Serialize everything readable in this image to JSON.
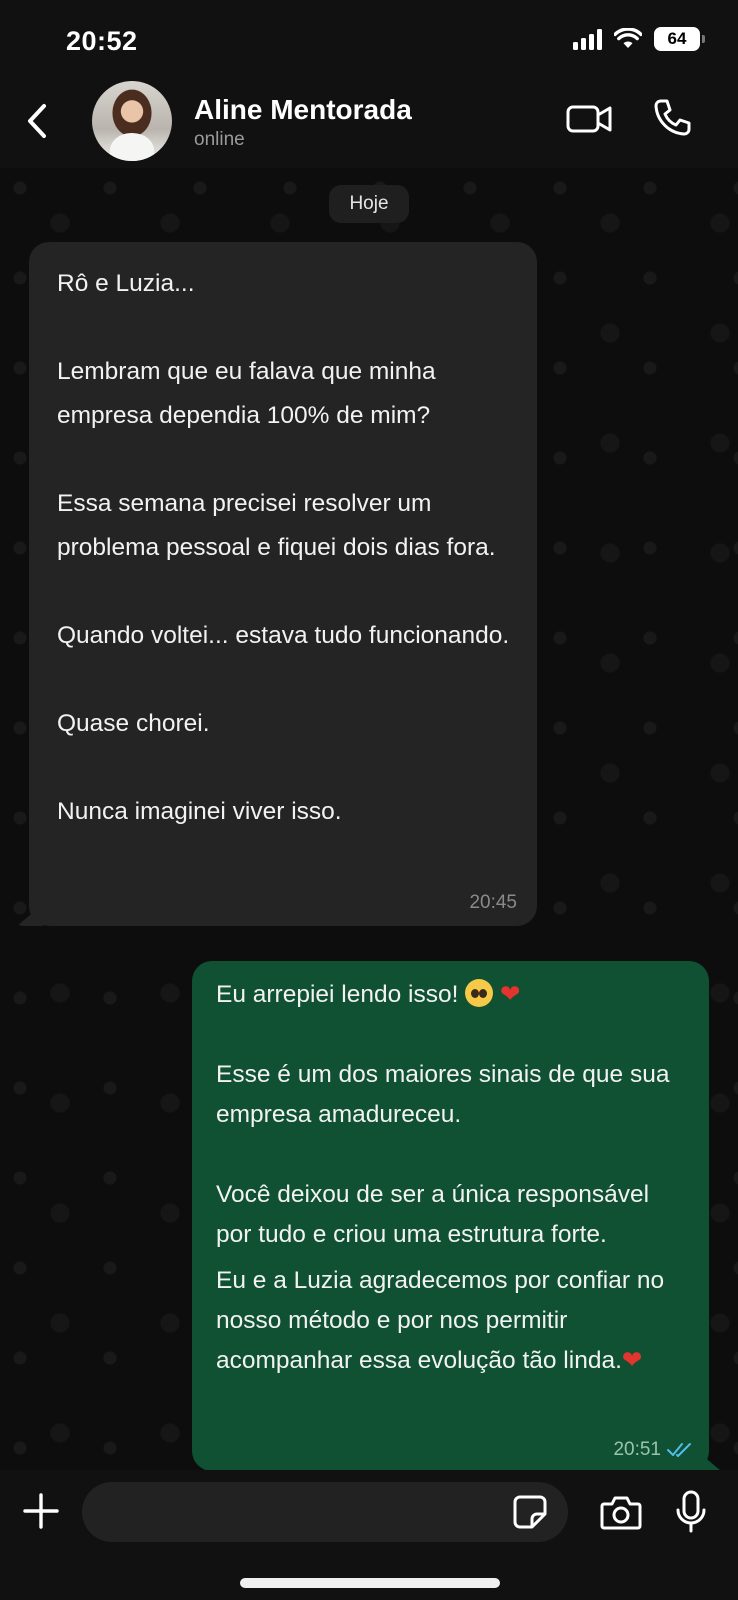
{
  "status_bar": {
    "time": "20:52",
    "battery": "64"
  },
  "header": {
    "contact_name": "Aline Mentorada",
    "contact_status": "online"
  },
  "chat": {
    "date_label": "Hoje",
    "incoming": {
      "paragraphs": [
        "Rô e Luzia...",
        "Lembram que eu falava que minha empresa dependia 100% de mim?",
        "Essa semana precisei resolver um problema pessoal e fiquei dois dias fora.",
        "Quando voltei... estava tudo funcionando.",
        "Quase chorei.",
        "Nunca imaginei viver isso."
      ],
      "time": "20:45"
    },
    "outgoing": {
      "line1": "Eu arrepiei lendo isso! ",
      "line1_emojis": [
        "pleading-face-emoji",
        "red-heart-emoji"
      ],
      "paragraphs": [
        "Esse é um dos maiores sinais de que sua empresa amadureceu.",
        "Você deixou de ser a única responsável por tudo e criou uma estrutura forte.",
        "Eu e a Luzia agradecemos por confiar no nosso método e por nos permitir acompanhar essa evolução tão linda."
      ],
      "time": "20:51",
      "read_receipt": "double-check-icon"
    }
  },
  "composer": {
    "message_value": "",
    "placeholder": ""
  },
  "colors": {
    "incoming_bubble": "#242424",
    "outgoing_bubble": "#0f5132",
    "read_tick": "#53bdeb"
  }
}
